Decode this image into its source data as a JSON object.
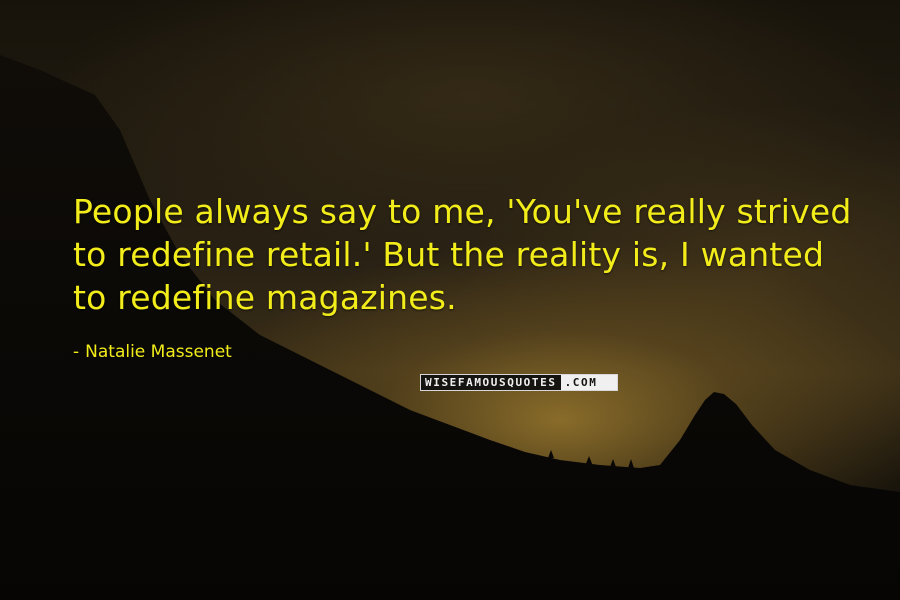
{
  "quote": {
    "text": "People always say to me, 'You've really strived to redefine retail.' But the reality is, I wanted to redefine magazines.",
    "author_dash": "-",
    "author": "Natalie Massenet"
  },
  "watermark": {
    "main": "WISEFAMOUSQUOTES",
    "tld": ".COM"
  },
  "colors": {
    "text": "#f2ec1a",
    "sky_glow": "#a88432",
    "silhouette": "#0b0906"
  }
}
